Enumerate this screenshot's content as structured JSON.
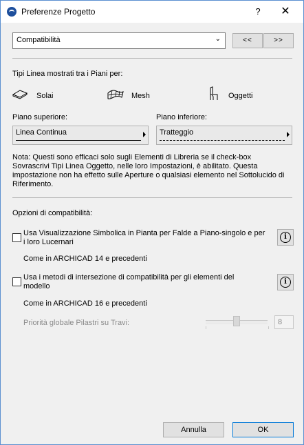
{
  "window": {
    "title": "Preferenze Progetto",
    "help": "?",
    "close": "✕"
  },
  "category": {
    "selected": "Compatibilità",
    "prev": "<<",
    "next": ">>"
  },
  "linetypes": {
    "heading": "Tipi Linea mostrati tra i Piani per:",
    "types": [
      "Solai",
      "Mesh",
      "Oggetti"
    ],
    "upper_label": "Piano superiore:",
    "upper_value": "Linea Continua",
    "lower_label": "Piano inferiore:",
    "lower_value": "Tratteggio",
    "note": "Nota: Questi sono efficaci solo sugli Elementi di Libreria se il check-box Sovrascrivi Tipi Linea Oggetto, nelle loro Impostazioni, è abilitato. Questa impostazione non ha effetto sulle Aperture o qualsiasi elemento nel Sottolucido di Riferimento."
  },
  "compat": {
    "heading": "Opzioni di compatibilità:",
    "opt1_label": "Usa Visualizzazione Simbolica in Pianta per Falde a Piano-singolo e per i loro Lucernari",
    "opt1_checked": false,
    "opt1_note": "Come in ARCHICAD 14 e precedenti",
    "opt2_label": "Usa i metodi di intersezione di compatibilità per gli elementi del modello",
    "opt2_checked": false,
    "opt2_note": "Come in ARCHICAD 16 e precedenti",
    "priority_label": "Priorità globale Pilastri su Travi:",
    "priority_value": "8"
  },
  "footer": {
    "cancel": "Annulla",
    "ok": "OK"
  }
}
